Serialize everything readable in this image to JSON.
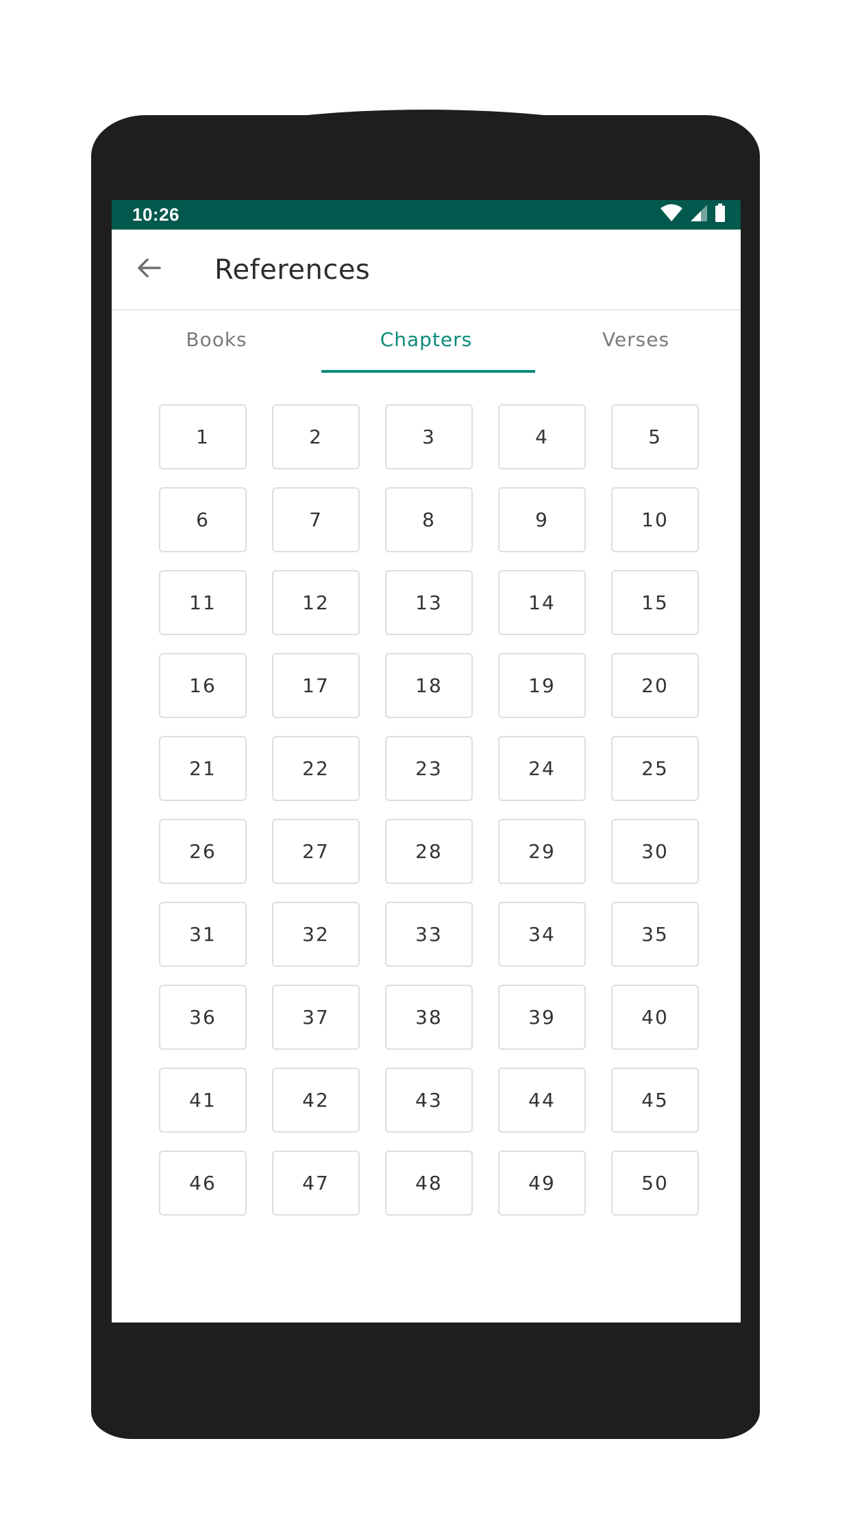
{
  "status_bar": {
    "time": "10:26",
    "icons": [
      "wifi-icon",
      "signal-icon",
      "battery-icon"
    ],
    "background": "#03594d"
  },
  "app_bar": {
    "title": "References",
    "back_icon": "arrow-left-icon"
  },
  "tabs": [
    {
      "label": "Books",
      "active": false
    },
    {
      "label": "Chapters",
      "active": true
    },
    {
      "label": "Verses",
      "active": false
    }
  ],
  "accent_color": "#0a8a7a",
  "chapters": [
    "1",
    "2",
    "3",
    "4",
    "5",
    "6",
    "7",
    "8",
    "9",
    "10",
    "11",
    "12",
    "13",
    "14",
    "15",
    "16",
    "17",
    "18",
    "19",
    "20",
    "21",
    "22",
    "23",
    "24",
    "25",
    "26",
    "27",
    "28",
    "29",
    "30",
    "31",
    "32",
    "33",
    "34",
    "35",
    "36",
    "37",
    "38",
    "39",
    "40",
    "41",
    "42",
    "43",
    "44",
    "45",
    "46",
    "47",
    "48",
    "49",
    "50"
  ]
}
